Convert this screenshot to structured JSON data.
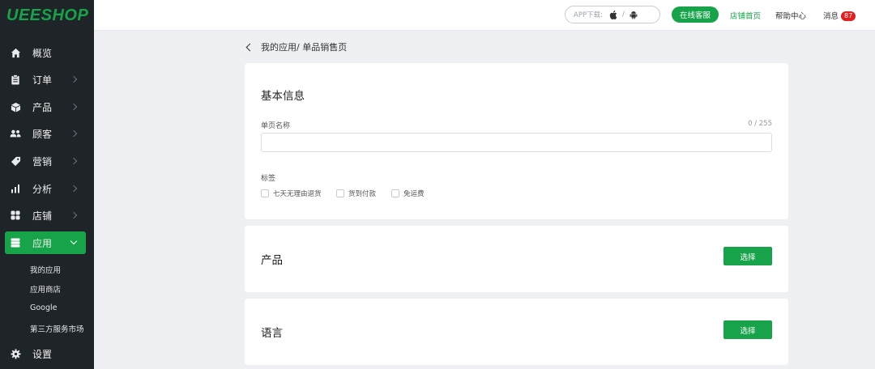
{
  "brand": {
    "logo_text": "UEESHOP",
    "accent_color": "#16a34a"
  },
  "sidebar": {
    "items": [
      {
        "label": "概览",
        "icon": "home-icon",
        "has_chevron": false
      },
      {
        "label": "订单",
        "icon": "clipboard-icon",
        "has_chevron": true
      },
      {
        "label": "产品",
        "icon": "box-icon",
        "has_chevron": true
      },
      {
        "label": "顾客",
        "icon": "users-icon",
        "has_chevron": true
      },
      {
        "label": "营销",
        "icon": "tag-icon",
        "has_chevron": true
      },
      {
        "label": "分析",
        "icon": "bar-chart-icon",
        "has_chevron": true
      },
      {
        "label": "店铺",
        "icon": "grid-icon",
        "has_chevron": true
      },
      {
        "label": "应用",
        "icon": "apps-icon",
        "has_chevron": true,
        "active": true
      },
      {
        "label": "设置",
        "icon": "gear-icon",
        "has_chevron": false
      }
    ],
    "sub_items": [
      "我的应用",
      "应用商店",
      "Google",
      "第三方服务市场"
    ]
  },
  "topbar": {
    "app_download_label": "APP下载:",
    "app_download_separator": "/",
    "online_service_label": "在线客服",
    "store_home_label": "店铺首页",
    "help_center_label": "帮助中心",
    "messages_label": "消息",
    "messages_count": "87"
  },
  "breadcrumb": {
    "text": "我的应用/ 单品销售页"
  },
  "basic_info": {
    "title": "基本信息",
    "page_name_label": "单页名称",
    "page_name_counter": "0 / 255",
    "page_name_value": "",
    "tags_label": "标签",
    "tags": [
      "七天无理由退货",
      "货到付款",
      "免运费"
    ]
  },
  "products_section": {
    "title": "产品",
    "select_label": "选择"
  },
  "language_section": {
    "title": "语言",
    "select_label": "选择"
  }
}
